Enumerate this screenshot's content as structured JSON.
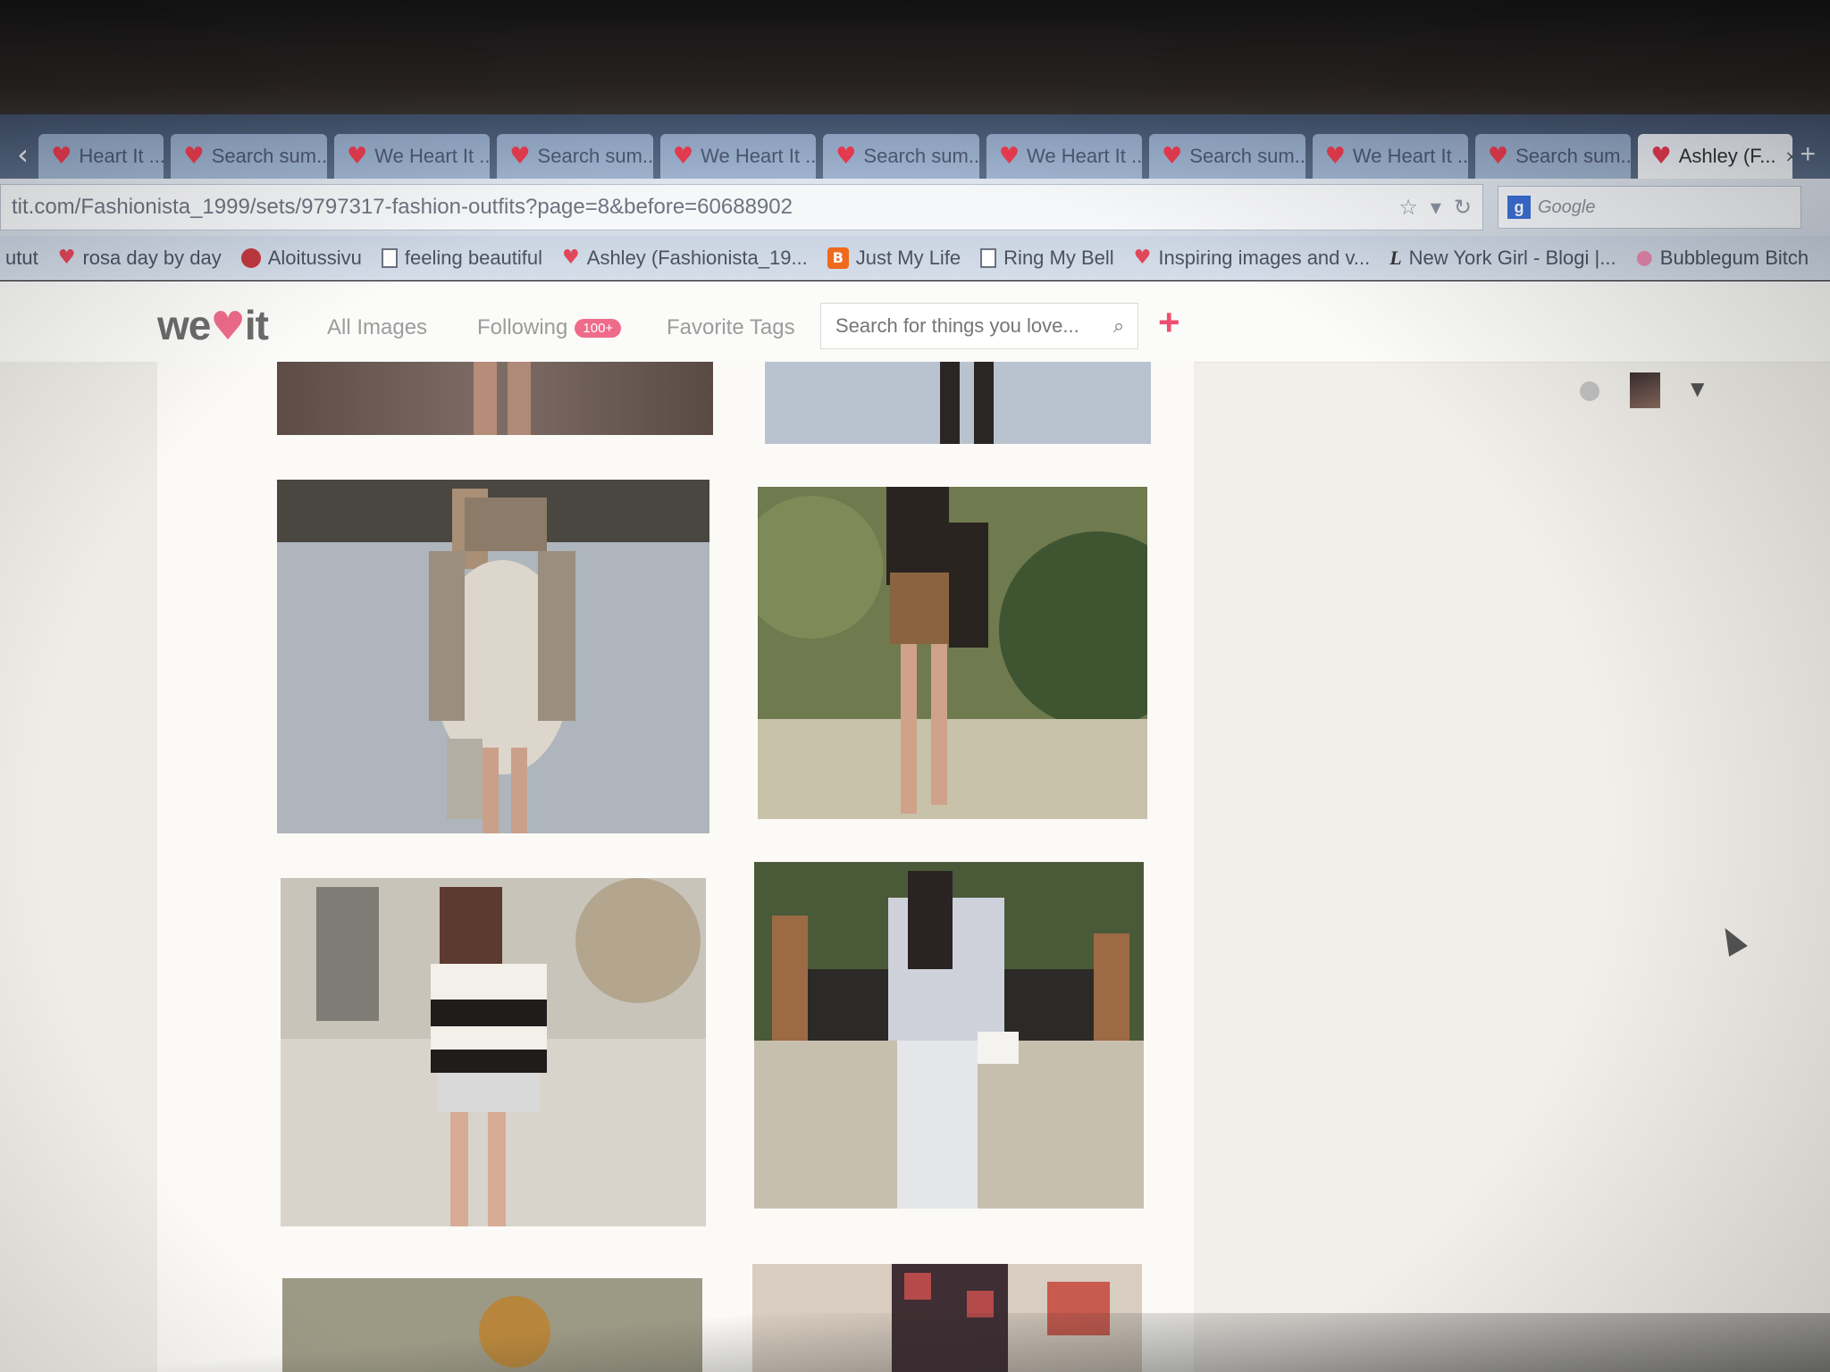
{
  "browser": {
    "tabs": [
      {
        "label": "Heart It ..."
      },
      {
        "label": "Search sum..."
      },
      {
        "label": "We Heart It ..."
      },
      {
        "label": "Search sum..."
      },
      {
        "label": "We Heart It ..."
      },
      {
        "label": "Search sum..."
      },
      {
        "label": "We Heart It ..."
      },
      {
        "label": "Search sum..."
      },
      {
        "label": "We Heart It ..."
      },
      {
        "label": "Search sum..."
      },
      {
        "label": "Ashley (F..."
      }
    ],
    "tab_close": "×",
    "new_tab": "+",
    "url": "tit.com/Fashionista_1999/sets/9797317-fashion-outfits?page=8&before=60688902",
    "search_engine_placeholder": "Google",
    "bookmarks": [
      {
        "label": "utut",
        "icon": "heart-icon"
      },
      {
        "label": "rosa day by day",
        "icon": "globe-icon"
      },
      {
        "label": "Aloitussivu",
        "icon": "page-icon"
      },
      {
        "label": "feeling beautiful",
        "icon": "heart-icon"
      },
      {
        "label": "Ashley (Fashionista_19...",
        "icon": "blogger-icon"
      },
      {
        "label": "Just My Life",
        "icon": "page-icon"
      },
      {
        "label": "Ring My Bell",
        "icon": "heart-icon"
      },
      {
        "label": "Inspiring images and v...",
        "icon": "l-icon"
      },
      {
        "label": "New York Girl - Blogi |...",
        "icon": "blob-icon"
      },
      {
        "label": "Bubblegum Bitch",
        "icon": "l-icon"
      }
    ]
  },
  "site": {
    "logo_left": "we",
    "logo_heart": "♥",
    "logo_right": "it",
    "nav": {
      "all_images": "All Images",
      "following": "Following",
      "following_badge": "100+",
      "favorite_tags": "Favorite Tags"
    },
    "search_placeholder": "Search for things you love...",
    "add_button": "+"
  },
  "colors": {
    "brand_pink": "#ee6b8a",
    "tab_heart": "#e63b4f",
    "tab_bg": "#9fb3cf"
  }
}
